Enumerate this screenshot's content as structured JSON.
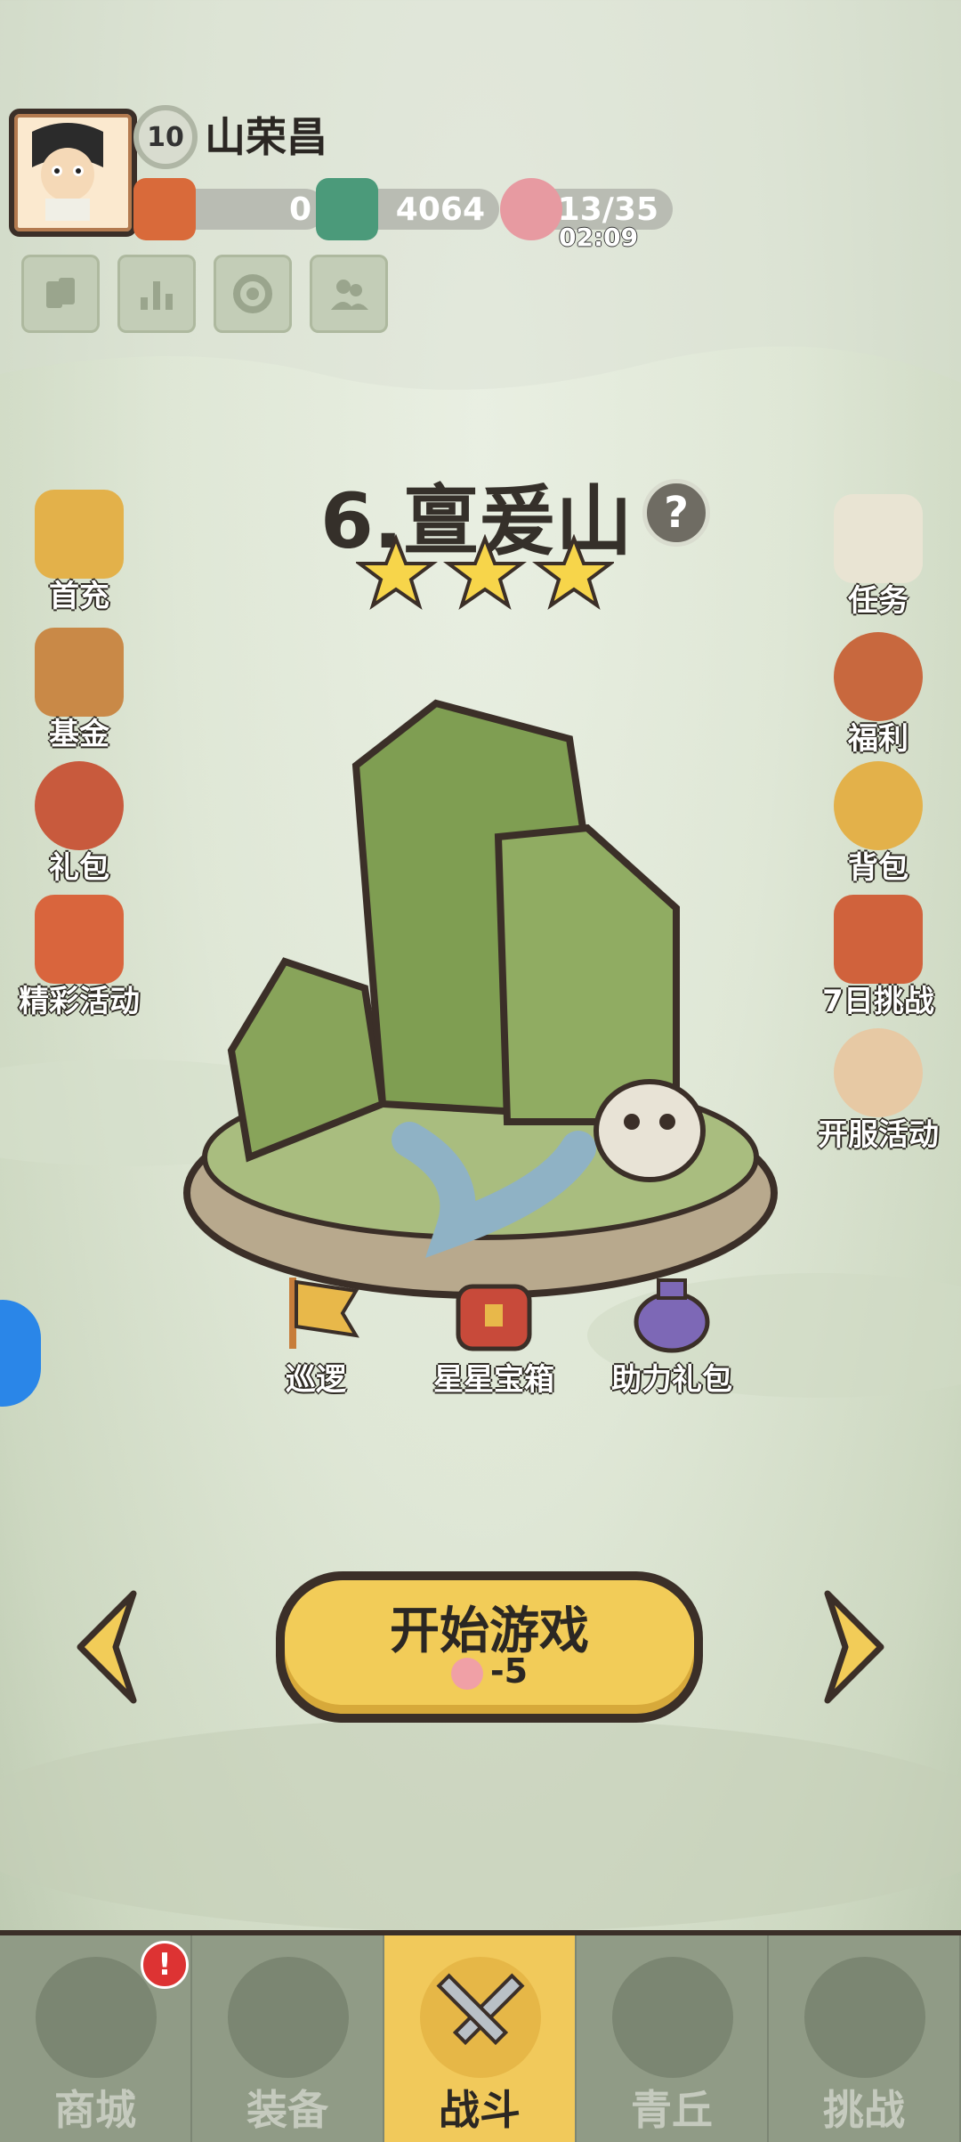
{
  "player": {
    "level": "10",
    "name": "山荣昌"
  },
  "resources": {
    "tickets": "0",
    "jade": "4064",
    "stamina": "13/35",
    "stamina_timer": "02:09"
  },
  "stage": {
    "title": "6.亶爰山",
    "stars": 3
  },
  "left_menu": [
    {
      "label": "首充"
    },
    {
      "label": "基金"
    },
    {
      "label": "礼包"
    },
    {
      "label": "精彩活动"
    }
  ],
  "right_menu": [
    {
      "label": "任务"
    },
    {
      "label": "福利"
    },
    {
      "label": "背包"
    },
    {
      "label": "7日挑战"
    },
    {
      "label": "开服活动"
    }
  ],
  "stage_actions": [
    {
      "label": "巡逻"
    },
    {
      "label": "星星宝箱"
    },
    {
      "label": "助力礼包"
    }
  ],
  "start_button": {
    "label": "开始游戏",
    "cost": "-5"
  },
  "bottom_nav": [
    {
      "label": "商城",
      "badge": "!"
    },
    {
      "label": "装备"
    },
    {
      "label": "战斗"
    },
    {
      "label": "青丘"
    },
    {
      "label": "挑战"
    }
  ],
  "colors": {
    "accent": "#f1c95b",
    "outline": "#3b2f28",
    "badge": "#dd3333"
  }
}
